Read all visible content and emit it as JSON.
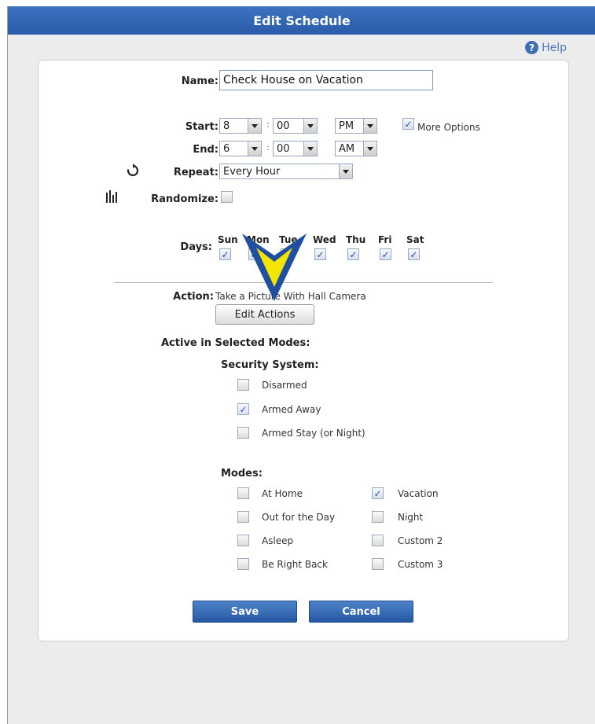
{
  "title": "Edit Schedule",
  "help": "Help",
  "name": {
    "label": "Name:",
    "value": "Check House on Vacation"
  },
  "start": {
    "label": "Start:",
    "hour": "8",
    "minute": "00",
    "ampm": "PM"
  },
  "more_options": {
    "label": "More Options",
    "checked": true
  },
  "end": {
    "label": "End:",
    "hour": "6",
    "minute": "00",
    "ampm": "AM"
  },
  "repeat": {
    "label": "Repeat:",
    "value": "Every Hour"
  },
  "randomize": {
    "label": "Randomize:",
    "checked": false
  },
  "days": {
    "label": "Days:",
    "items": [
      {
        "name": "Sun",
        "checked": true
      },
      {
        "name": "Mon",
        "checked": true
      },
      {
        "name": "Tue",
        "checked": true
      },
      {
        "name": "Wed",
        "checked": true
      },
      {
        "name": "Thu",
        "checked": true
      },
      {
        "name": "Fri",
        "checked": true
      },
      {
        "name": "Sat",
        "checked": true
      }
    ]
  },
  "action": {
    "label": "Action:",
    "value": "Take a Picture With Hall Camera",
    "button": "Edit Actions"
  },
  "active_modes": {
    "heading": "Active in Selected Modes:",
    "security_heading": "Security System:",
    "security": [
      {
        "label": "Disarmed",
        "checked": false
      },
      {
        "label": "Armed Away",
        "checked": true
      },
      {
        "label": "Armed Stay (or Night)",
        "checked": false
      }
    ],
    "modes_heading": "Modes:",
    "modes_left": [
      {
        "label": "At Home",
        "checked": false
      },
      {
        "label": "Out for the Day",
        "checked": false
      },
      {
        "label": "Asleep",
        "checked": false
      },
      {
        "label": "Be Right Back",
        "checked": false
      }
    ],
    "modes_right": [
      {
        "label": "Vacation",
        "checked": true
      },
      {
        "label": "Night",
        "checked": false
      },
      {
        "label": "Custom 2",
        "checked": false
      },
      {
        "label": "Custom 3",
        "checked": false
      }
    ]
  },
  "buttons": {
    "save": "Save",
    "cancel": "Cancel"
  },
  "colors": {
    "titlebar": "#2a5ba8",
    "button": "#2659a3",
    "arrow_fill": "#f2e600",
    "arrow_outline": "#1f4f9e"
  }
}
